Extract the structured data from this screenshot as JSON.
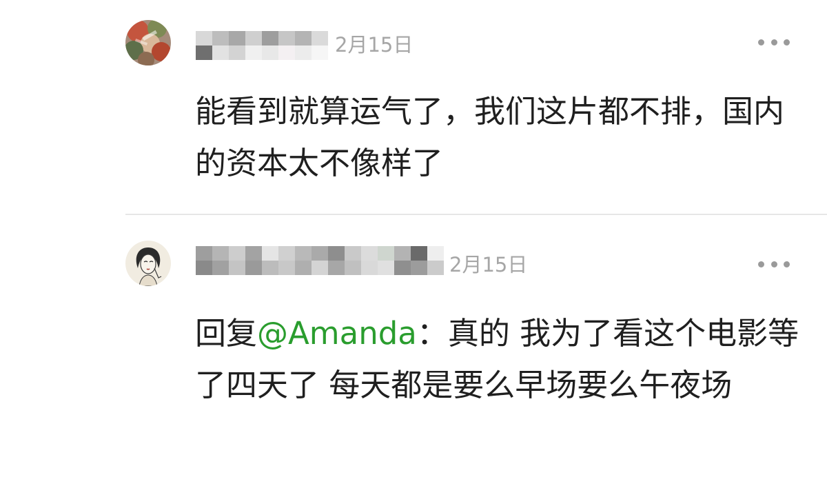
{
  "comments": [
    {
      "username_blurred": true,
      "date": "2月15日",
      "text": "能看到就算运气了，我们这片都不排，国内的资本太不像样了",
      "more_icon": "more-dots-icon",
      "avatar_icon": "user-avatar"
    },
    {
      "username_blurred": true,
      "date": "2月15日",
      "reply_prefix": "回复",
      "mention": "@Amanda",
      "text": "：真的 我为了看这个电影等了四天了 每天都是要么早场要么午夜场",
      "more_icon": "more-dots-icon",
      "avatar_icon": "user-avatar"
    }
  ],
  "colors": {
    "mention": "#2a9d2e",
    "date": "#a6a6a6",
    "text": "#1f1f1f",
    "divider": "#e6e6e6"
  }
}
